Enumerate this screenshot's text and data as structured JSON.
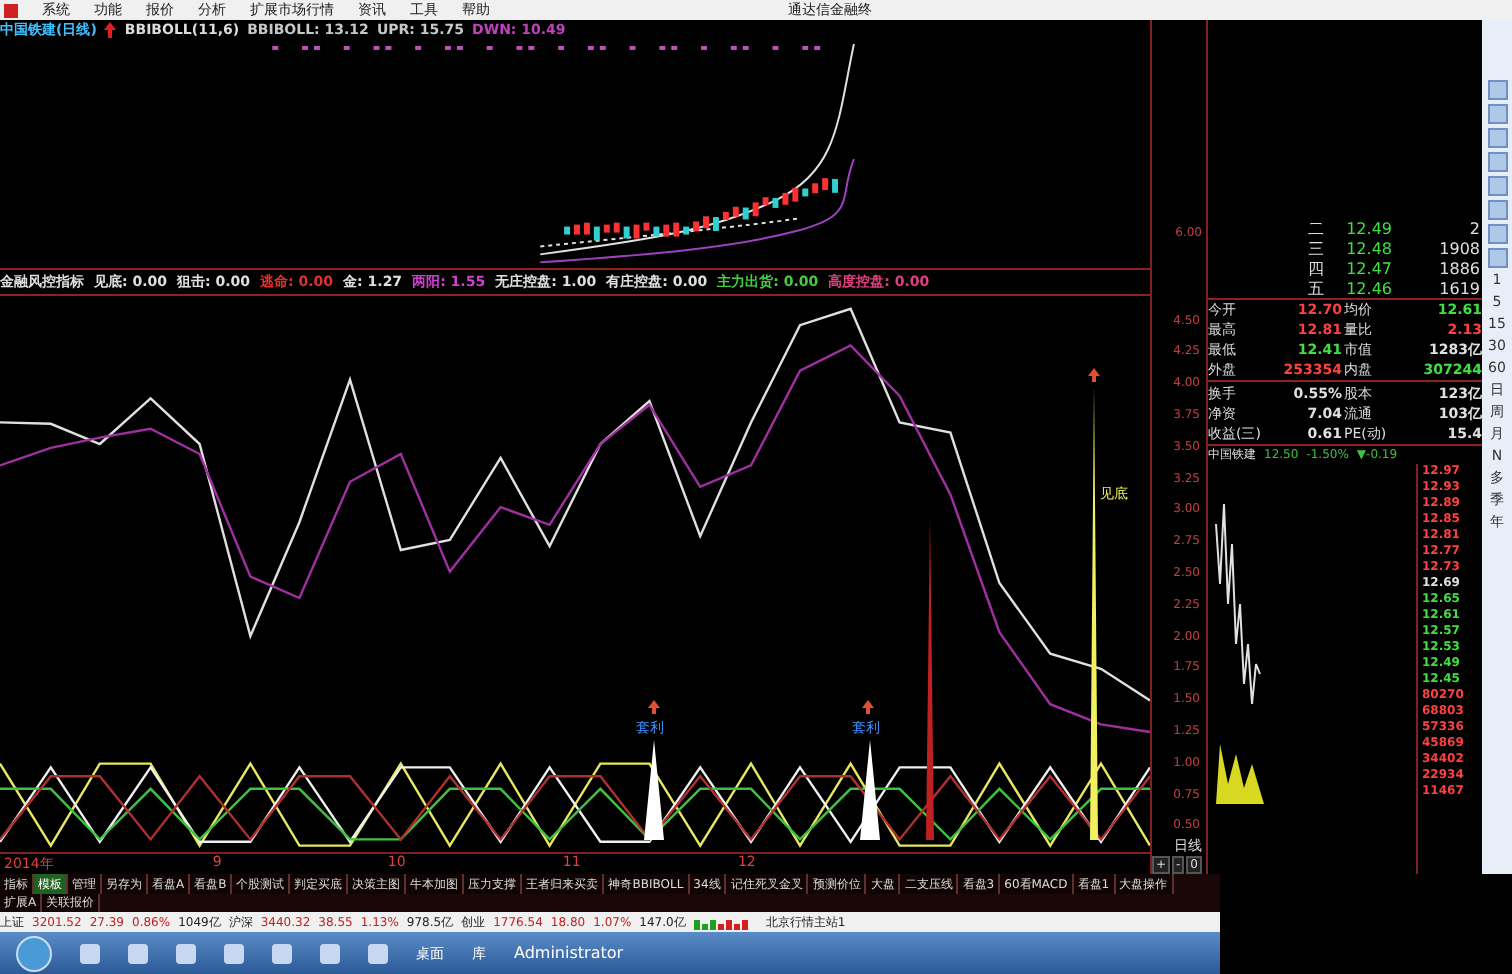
{
  "menu": {
    "items": [
      "系统",
      "功能",
      "报价",
      "分析",
      "扩展市场行情",
      "资讯",
      "工具",
      "帮助"
    ],
    "title": "通达信金融终"
  },
  "main_chart": {
    "stock": "中国铁建(日线)",
    "indicator": "BBIBOLL(11,6)",
    "readings": [
      {
        "label": "BBIBOLL: 13.12",
        "color": "#c8c8c8"
      },
      {
        "label": "UPR: 15.75",
        "color": "#c8c8c8"
      },
      {
        "label": "DWN: 10.49",
        "color": "#c040c0"
      }
    ],
    "axis_label": "6.00"
  },
  "indicator_chart": {
    "name": "金融风控指标",
    "readings": [
      {
        "label": "见底: 0.00",
        "color": "#e0e0e0"
      },
      {
        "label": "狙击: 0.00",
        "color": "#e0e0e0"
      },
      {
        "label": "逃命: 0.00",
        "color": "#e03030"
      },
      {
        "label": "金: 1.27",
        "color": "#e0e0e0"
      },
      {
        "label": "两阳: 1.55",
        "color": "#d040d0"
      },
      {
        "label": "无庄控盘: 1.00",
        "color": "#e0e0e0"
      },
      {
        "label": "有庄控盘: 0.00",
        "color": "#e0e0e0"
      },
      {
        "label": "主力出货: 0.00",
        "color": "#40d040"
      },
      {
        "label": "高度控盘: 0.00",
        "color": "#e04080"
      }
    ],
    "year_label": "2014年",
    "chart_data": {
      "type": "line",
      "x": [
        7.75,
        8.04,
        8.32,
        8.61,
        8.89,
        9.18,
        9.46,
        9.75,
        10.04,
        10.32,
        10.61,
        10.89,
        11.18,
        11.46,
        11.75,
        12.04,
        12.32,
        12.61,
        12.89,
        13.18,
        13.46,
        13.75,
        14.04,
        14.32
      ],
      "xlim": [
        7.75,
        14.32
      ],
      "ylim": [
        0.11,
        6.87
      ],
      "xticks": [
        {
          "value": 9,
          "label": "9"
        },
        {
          "value": 10,
          "label": "10"
        },
        {
          "value": 11,
          "label": "11"
        },
        {
          "value": 12,
          "label": "12"
        }
      ],
      "yticks": [
        {
          "value": 4.5,
          "label": "4.50"
        },
        {
          "value": 4.25,
          "label": "4.25"
        },
        {
          "value": 4.0,
          "label": "4.00"
        },
        {
          "value": 3.75,
          "label": "3.75"
        },
        {
          "value": 3.5,
          "label": "3.50"
        },
        {
          "value": 3.25,
          "label": "3.25"
        },
        {
          "value": 3.0,
          "label": "3.00"
        },
        {
          "value": 2.75,
          "label": "2.75"
        },
        {
          "value": 2.5,
          "label": "2.50"
        },
        {
          "value": 2.25,
          "label": "2.25"
        },
        {
          "value": 2.0,
          "label": "2.00"
        },
        {
          "value": 1.75,
          "label": "1.75"
        },
        {
          "value": 1.5,
          "label": "1.50"
        },
        {
          "value": 1.25,
          "label": "1.25"
        },
        {
          "value": 1.0,
          "label": "1.00"
        },
        {
          "value": 0.75,
          "label": "0.75"
        },
        {
          "value": 0.5,
          "label": "0.50"
        }
      ],
      "series": [
        {
          "color": "#e0e0e0",
          "values": [
            3.7,
            3.69,
            3.53,
            3.89,
            3.53,
            2.01,
            2.91,
            4.04,
            2.69,
            2.77,
            3.42,
            2.72,
            3.53,
            3.87,
            2.8,
            3.7,
            4.47,
            4.6,
            3.7,
            3.62,
            2.43,
            1.87,
            1.75,
            1.5
          ]
        },
        {
          "color": "#a030a0",
          "values": [
            3.36,
            3.5,
            3.58,
            3.65,
            3.45,
            2.48,
            2.31,
            3.23,
            3.45,
            2.52,
            3.03,
            2.89,
            3.53,
            3.84,
            3.19,
            3.36,
            4.11,
            4.31,
            3.91,
            3.13,
            2.04,
            1.47,
            1.31,
            1.25
          ]
        },
        {
          "color": "#e8e860",
          "values": [
            1,
            0.35,
            1,
            1,
            0.35,
            1,
            0.35,
            0.35,
            1,
            0.35,
            1,
            0.35,
            1,
            1,
            0.35,
            1,
            0.35,
            1,
            0.35,
            0.35,
            1,
            0.35,
            1,
            0.35
          ]
        },
        {
          "color": "#f0f0f0",
          "values": [
            0.38,
            0.97,
            0.38,
            0.97,
            0.38,
            0.38,
            0.97,
            0.38,
            0.97,
            0.97,
            0.38,
            0.97,
            0.38,
            0.38,
            0.97,
            0.38,
            0.97,
            0.38,
            0.97,
            0.97,
            0.38,
            0.97,
            0.38,
            0.97
          ]
        },
        {
          "color": "#40c040",
          "values": [
            0.8,
            0.8,
            0.4,
            0.8,
            0.4,
            0.8,
            0.8,
            0.4,
            0.4,
            0.8,
            0.8,
            0.4,
            0.8,
            0.4,
            0.8,
            0.8,
            0.4,
            0.8,
            0.8,
            0.4,
            0.8,
            0.4,
            0.8,
            0.8
          ]
        },
        {
          "color": "#b03030",
          "values": [
            0.4,
            0.9,
            0.9,
            0.4,
            0.9,
            0.4,
            0.9,
            0.9,
            0.4,
            0.9,
            0.4,
            0.9,
            0.9,
            0.4,
            0.9,
            0.4,
            0.9,
            0.9,
            0.4,
            0.9,
            0.4,
            0.9,
            0.4,
            0.9
          ]
        }
      ]
    },
    "markers": [
      {
        "label": "见底",
        "kind": "bottom"
      },
      {
        "label": "套利",
        "kind": "arbitrage"
      },
      {
        "label": "套利",
        "kind": "arbitrage"
      }
    ]
  },
  "order_book": [
    {
      "level": "二",
      "price": "12.49",
      "volume": "2"
    },
    {
      "level": "三",
      "price": "12.48",
      "volume": "1908"
    },
    {
      "level": "四",
      "price": "12.47",
      "volume": "1886"
    },
    {
      "level": "五",
      "price": "12.46",
      "volume": "1619"
    }
  ],
  "stats": [
    [
      {
        "label": "今开",
        "value": "12.70",
        "color": "#ff4040"
      },
      {
        "label": "均价",
        "value": "12.61",
        "color": "#40e040"
      }
    ],
    [
      {
        "label": "最高",
        "value": "12.81",
        "color": "#ff4040"
      },
      {
        "label": "量比",
        "value": "2.13",
        "color": "#ff4040"
      }
    ],
    [
      {
        "label": "最低",
        "value": "12.41",
        "color": "#40e040"
      },
      {
        "label": "市值",
        "value": "1283亿",
        "color": "#e0e0e0"
      }
    ],
    [
      {
        "label": "外盘",
        "value": "253354",
        "color": "#ff4040"
      },
      {
        "label": "内盘",
        "value": "307244",
        "color": "#40e040"
      }
    ],
    [
      {
        "label": "换手",
        "value": "0.55%",
        "color": "#e0e0e0"
      },
      {
        "label": "股本",
        "value": "123亿",
        "color": "#e0e0e0"
      }
    ],
    [
      {
        "label": "净资",
        "value": "7.04",
        "color": "#e0e0e0"
      },
      {
        "label": "流通",
        "value": "103亿",
        "color": "#e0e0e0"
      }
    ],
    [
      {
        "label": "收益(三)",
        "value": "0.61",
        "color": "#e0e0e0"
      },
      {
        "label": "PE(动)",
        "value": "15.4",
        "color": "#e0e0e0"
      }
    ]
  ],
  "mini_chart": {
    "stock": "中国铁建",
    "price": "12.50",
    "change_pct": "-1.50%",
    "change": "▼-0.19",
    "scale": [
      {
        "text": "12.97",
        "color": "#ff4040"
      },
      {
        "text": "12.93",
        "color": "#ff4040"
      },
      {
        "text": "12.89",
        "color": "#ff4040"
      },
      {
        "text": "12.85",
        "color": "#ff4040"
      },
      {
        "text": "12.81",
        "color": "#ff4040"
      },
      {
        "text": "12.77",
        "color": "#ff4040"
      },
      {
        "text": "12.73",
        "color": "#ff4040"
      },
      {
        "text": "12.69",
        "color": "#e0e0e0"
      },
      {
        "text": "12.65",
        "color": "#40e040"
      },
      {
        "text": "12.61",
        "color": "#40e040"
      },
      {
        "text": "12.57",
        "color": "#40e040"
      },
      {
        "text": "12.53",
        "color": "#40e040"
      },
      {
        "text": "12.49",
        "color": "#40e040"
      },
      {
        "text": "12.45",
        "color": "#40e040"
      },
      {
        "text": "80270",
        "color": "#ff4040"
      },
      {
        "text": "68803",
        "color": "#ff4040"
      },
      {
        "text": "57336",
        "color": "#ff4040"
      },
      {
        "text": "45869",
        "color": "#ff4040"
      },
      {
        "text": "34402",
        "color": "#ff4040"
      },
      {
        "text": "22934",
        "color": "#ff4040"
      },
      {
        "text": "11467",
        "color": "#ff4040"
      }
    ]
  },
  "period_buttons": [
    "1",
    "5",
    "15",
    "30",
    "60",
    "日",
    "周",
    "月",
    "N",
    "多",
    "季",
    "年"
  ],
  "period_label": "日线",
  "zoom_buttons": [
    "+",
    "-",
    "0"
  ],
  "tabs": [
    {
      "label": "指标",
      "selected": false
    },
    {
      "label": "模板",
      "selected": true
    },
    {
      "label": "管理",
      "selected": false
    },
    {
      "label": "另存为",
      "selected": false
    },
    {
      "label": "看盘A",
      "selected": false
    },
    {
      "label": "看盘B",
      "selected": false
    },
    {
      "label": "个股测试",
      "selected": false
    },
    {
      "label": "判定买底",
      "selected": false
    },
    {
      "label": "决策主图",
      "selected": false
    },
    {
      "label": "牛本加图",
      "selected": false
    },
    {
      "label": "压力支撑",
      "selected": false
    },
    {
      "label": "王者归来买卖",
      "selected": false
    },
    {
      "label": "神奇BBIBOLL",
      "selected": false
    },
    {
      "label": "34线",
      "selected": false
    },
    {
      "label": "记住死叉金叉",
      "selected": false
    },
    {
      "label": "预测价位",
      "selected": false
    },
    {
      "label": "大盘",
      "selected": false
    },
    {
      "label": "二支压线",
      "selected": false
    },
    {
      "label": "看盘3",
      "selected": false
    },
    {
      "label": "60看MACD",
      "selected": false
    },
    {
      "label": "看盘1",
      "selected": false
    },
    {
      "label": "大盘操作",
      "selected": false
    }
  ],
  "sub_tabs": [
    "扩展A",
    "关联报价"
  ],
  "status_bar": [
    {
      "name": "上证",
      "value": "3201.52",
      "change": "27.39",
      "pct": "0.86%",
      "amount": "1049亿"
    },
    {
      "name": "沪深",
      "value": "3440.32",
      "change": "38.55",
      "pct": "1.13%",
      "amount": "978.5亿"
    },
    {
      "name": "创业",
      "value": "1776.54",
      "change": "18.80",
      "pct": "1.07%",
      "amount": "147.0亿"
    }
  ],
  "server": "北京行情主站1",
  "taskbar": {
    "desktop": "桌面",
    "library": "库",
    "user": "Administrator"
  }
}
